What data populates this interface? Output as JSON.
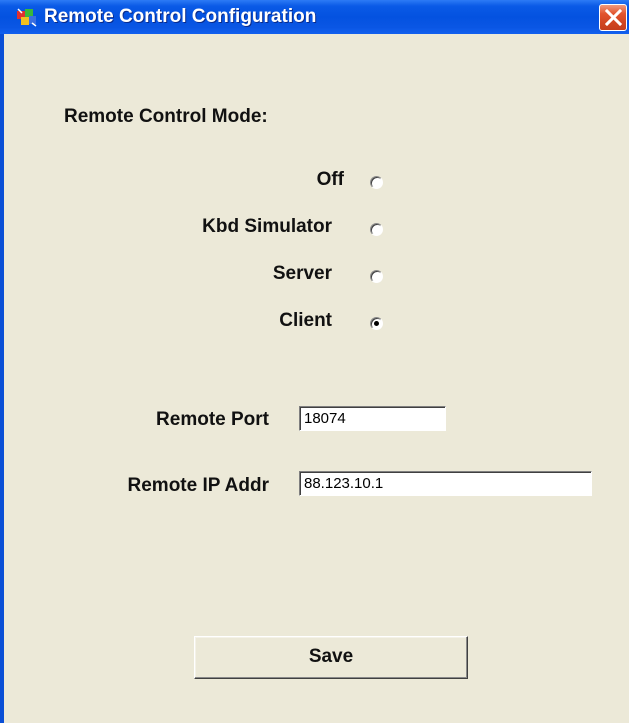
{
  "window": {
    "title": "Remote Control Configuration"
  },
  "mode": {
    "heading": "Remote Control Mode:",
    "options": [
      {
        "label": "Off",
        "selected": false
      },
      {
        "label": "Kbd Simulator",
        "selected": false
      },
      {
        "label": "Server",
        "selected": false
      },
      {
        "label": "Client",
        "selected": true
      }
    ]
  },
  "fields": {
    "port_label": "Remote Port",
    "port_value": "18074",
    "ip_label": "Remote IP Addr",
    "ip_value": "88.123.10.1"
  },
  "actions": {
    "save_label": "Save"
  },
  "colors": {
    "titlebar": "#0452e0",
    "client_background": "#ece9d8",
    "close_button": "#d14521"
  },
  "icons": {
    "app": "app-icon",
    "close": "close-icon"
  }
}
